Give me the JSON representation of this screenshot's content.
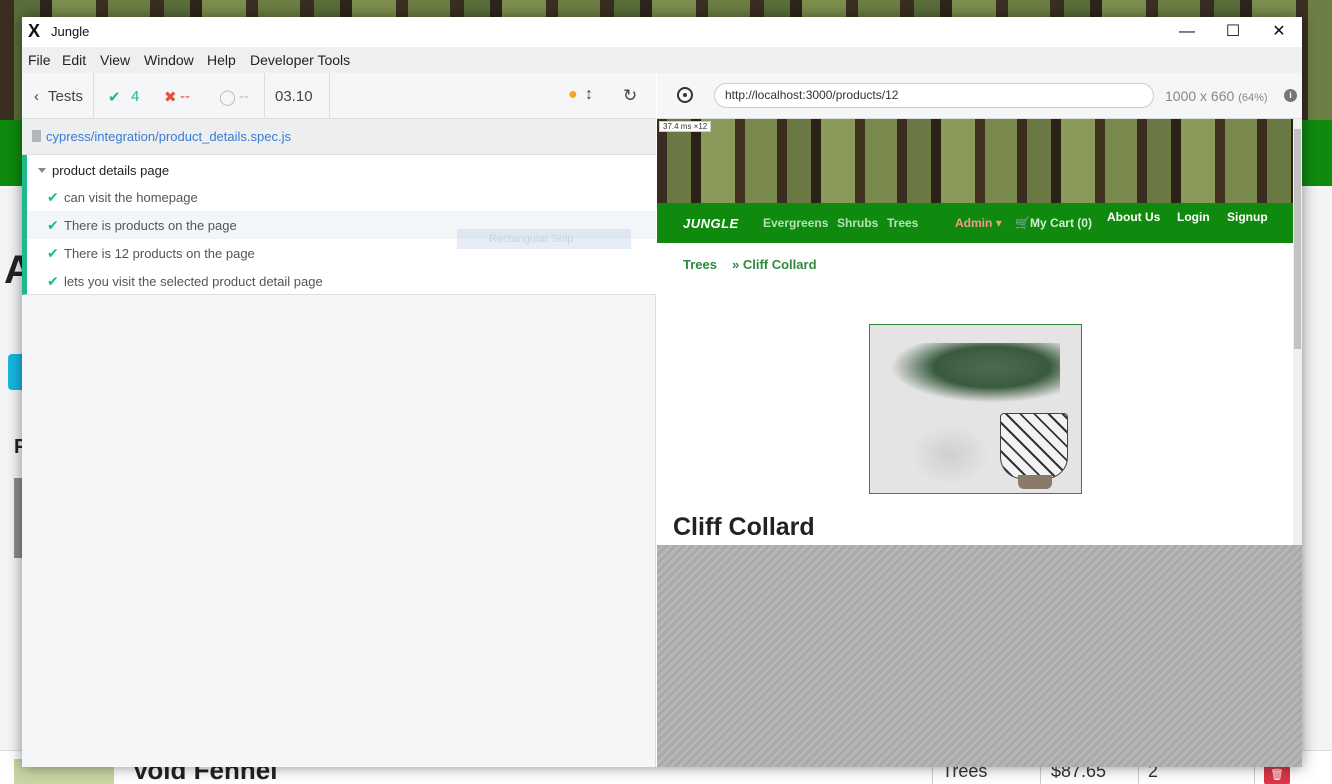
{
  "window": {
    "title": "Jungle",
    "controls": [
      "—",
      "☐",
      "✕"
    ]
  },
  "menu": [
    "File",
    "Edit",
    "View",
    "Window",
    "Help",
    "Developer Tools"
  ],
  "reporter": {
    "back_label": "Tests",
    "passed": "4",
    "failed": "--",
    "pending": "--",
    "duration": "03.10",
    "spec_path": "cypress/integration/product_details.spec.js",
    "suite_title": "product details page",
    "tests": [
      "can visit the homepage",
      "There is products on the page",
      "There is 12 products on the page",
      "lets you visit the selected product detail page"
    ],
    "snip_overlay": "Rectangular Snip"
  },
  "runner": {
    "url": "http://localhost:3000/products/12",
    "viewport": "1000 x 660",
    "viewport_pct": "(64%)",
    "timing": "37.4 ms ×12"
  },
  "aut": {
    "brand": "JUNGLE",
    "nav_left": [
      "Evergreens",
      "Shrubs",
      "Trees"
    ],
    "admin": "Admin",
    "cart": "My Cart (0)",
    "nav_right": [
      "About Us",
      "Login",
      "Signup"
    ],
    "breadcrumb": [
      "Trees",
      "» Cliff Collard"
    ],
    "product_title": "Cliff Collard"
  },
  "background": {
    "row_name": "Void Fennel",
    "row_category": "Trees",
    "row_price": "$87.65",
    "row_qty": "2"
  },
  "colors": {
    "nav_green": "#0f8a0f",
    "pass_green": "#1fb88a",
    "fail_red": "#e94f3c",
    "link_blue": "#3a7bd5",
    "pending_orange": "#f5a623"
  }
}
